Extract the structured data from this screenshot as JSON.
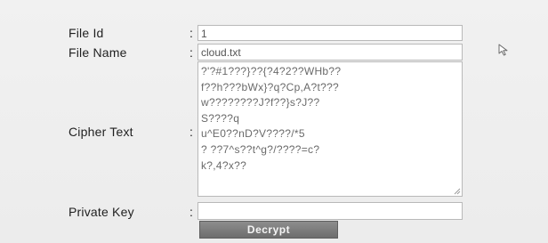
{
  "form": {
    "file_id": {
      "label": "File Id",
      "colon": ":",
      "value": "1"
    },
    "file_name": {
      "label": "File Name",
      "colon": ":",
      "value": "cloud.txt"
    },
    "cipher_text": {
      "label": "Cipher Text",
      "colon": ":",
      "lines": [
        "?'?#1???}??{?4?2??WHb??",
        "f??h???bWx}?q?Cp,A?t???",
        "w????????J?f??}s?J??",
        "S????q",
        "u^E0??nD?V????/*5",
        "? ??7^s??t^g?/????=c?",
        "k?,4?x??"
      ]
    },
    "private_key": {
      "label": "Private Key",
      "colon": ":",
      "value": ""
    },
    "decrypt_button": {
      "label": "Decrypt"
    }
  },
  "icons": {
    "cursor": "mouse-pointer-icon",
    "resize": "resize-grip-icon"
  },
  "colors": {
    "panel_background": "#eeeeee",
    "field_border": "#b9b9b9",
    "button_background": "#7a7a7a",
    "button_text": "#f4f4f4"
  }
}
